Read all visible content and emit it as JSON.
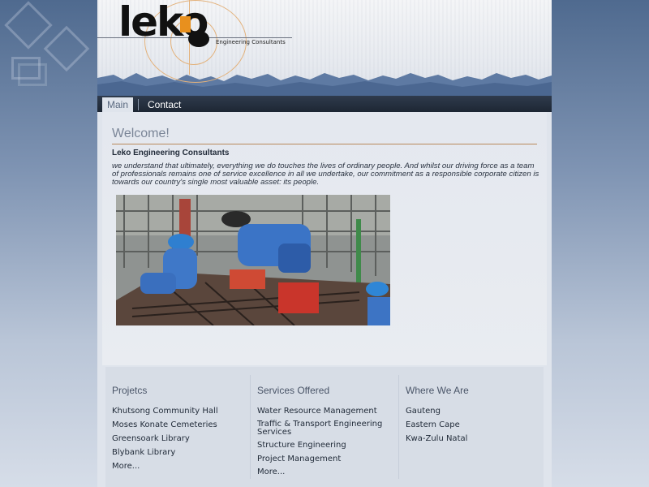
{
  "header": {
    "logo_text": "leko",
    "logo_subtitle": "Engineering Consultants"
  },
  "nav": {
    "tabs": [
      {
        "label": "Main",
        "active": true
      },
      {
        "label": "Contact",
        "active": false
      }
    ]
  },
  "main": {
    "heading": "Welcome!",
    "company_name": "Leko Engineering Consultants",
    "intro": "we understand that ultimately, everything we do touches the lives of ordinary people. And whilst our driving force as a team of professionals remains one of service excellence in all we undertake, our commitment as a responsible corporate citizen is towards our country's single most valuable asset: its people."
  },
  "footer": {
    "projects": {
      "heading": "Projetcs",
      "items": [
        "Khutsong Community Hall",
        "Moses Konate Cemeteries",
        "Greensoark Library",
        "Blybank Library",
        "More..."
      ]
    },
    "services": {
      "heading": "Services Offered",
      "items": [
        "Water Resource Management",
        "Traffic & Transport Engineering Services",
        "Structure Engineering",
        "Project Management",
        "More..."
      ]
    },
    "locations": {
      "heading": "Where We Are",
      "items": [
        "Gauteng",
        "Eastern Cape",
        "Kwa-Zulu Natal"
      ]
    }
  },
  "colors": {
    "accent": "#e8901e",
    "nav_bg": "#1d2633",
    "header_splash": "#5e7aa3"
  }
}
